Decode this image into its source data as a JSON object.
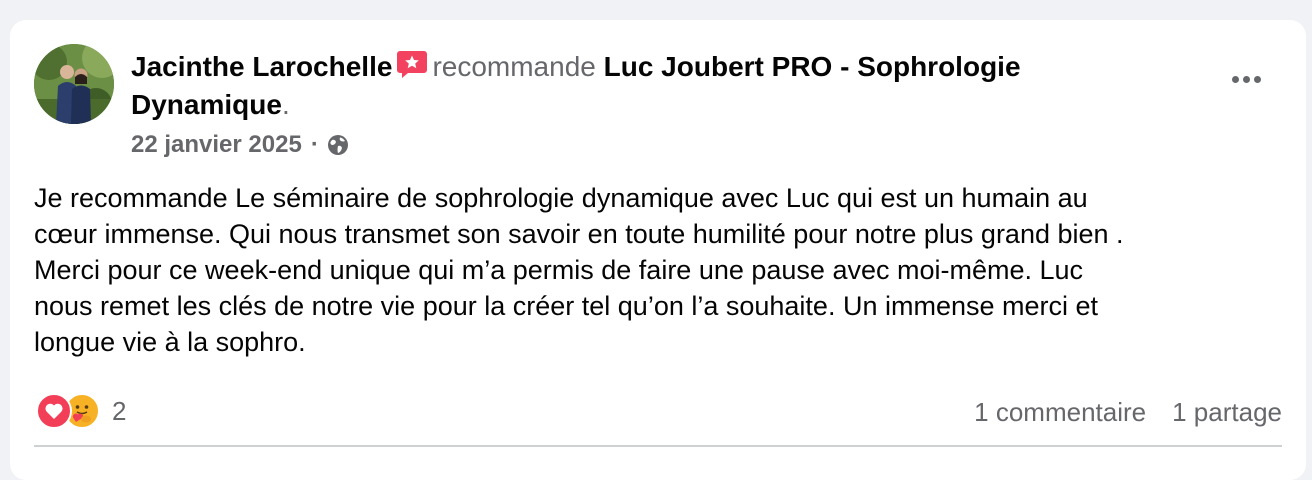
{
  "post": {
    "author_name": "Jacinthe Larochelle",
    "verb": "recommande",
    "page_name": "Luc Joubert PRO - Sophrologie Dynamique",
    "period": ".",
    "date": "22 janvier 2025",
    "separator": "·",
    "privacy_icon": "globe-icon",
    "recommend_badge_icon": "star-badge-icon",
    "more_icon": "more-options-icon",
    "body": "Je recommande Le séminaire de sophrologie dynamique avec Luc qui est un humain au\ncœur immense. Qui nous transmet son savoir en toute humilité pour notre plus grand bien .\nMerci pour ce week-end unique qui m’a permis de faire une pause avec moi-même. Luc\nnous remet les clés de notre vie pour la créer tel qu’on l’a souhaite. Un immense merci et\nlongue vie à la sophro."
  },
  "reactions": {
    "icons": [
      "love-reaction-icon",
      "care-reaction-icon"
    ],
    "count": "2"
  },
  "stats": {
    "comments": "1 commentaire",
    "shares": "1 partage"
  },
  "colors": {
    "background": "#f0f2f5",
    "card": "#ffffff",
    "primary_text": "#050505",
    "secondary_text": "#65676b",
    "recommend_badge": "#f3425f",
    "love": "#f33e58",
    "care": "#f7b125"
  }
}
